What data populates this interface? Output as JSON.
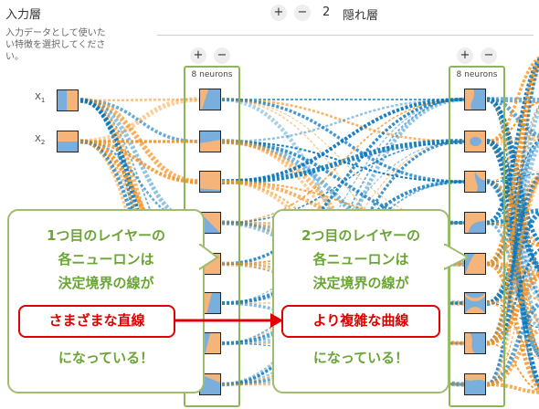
{
  "header": {
    "input_title": "入力層",
    "input_desc": "入力データとして使いたい特徴を選択してください。",
    "add_layer": "+",
    "remove_layer": "−",
    "layer_count": "2",
    "layer_label": "隠れ層"
  },
  "features": [
    {
      "label": "X",
      "sub": "1"
    },
    {
      "label": "X",
      "sub": "2"
    }
  ],
  "layers": [
    {
      "add": "+",
      "remove": "−",
      "neurons_label": "8 neurons"
    },
    {
      "add": "+",
      "remove": "−",
      "neurons_label": "8 neurons"
    }
  ],
  "callouts": {
    "left": {
      "line1": "1つ目のレイヤーの",
      "line2": "各ニューロンは",
      "line3": "決定境界の線が",
      "highlight": "さまざまな直線",
      "line4": "になっている！"
    },
    "right": {
      "line1": "2つ目のレイヤーの",
      "line2": "各ニューロンは",
      "line3": "決定境界の線が",
      "highlight": "より複雑な曲線",
      "line4": "になっている！"
    }
  },
  "colors": {
    "orange": "#f59322",
    "blue": "#0877bd",
    "green_border": "#8db65a",
    "callout_text": "#6aa535",
    "red": "#e00000"
  }
}
